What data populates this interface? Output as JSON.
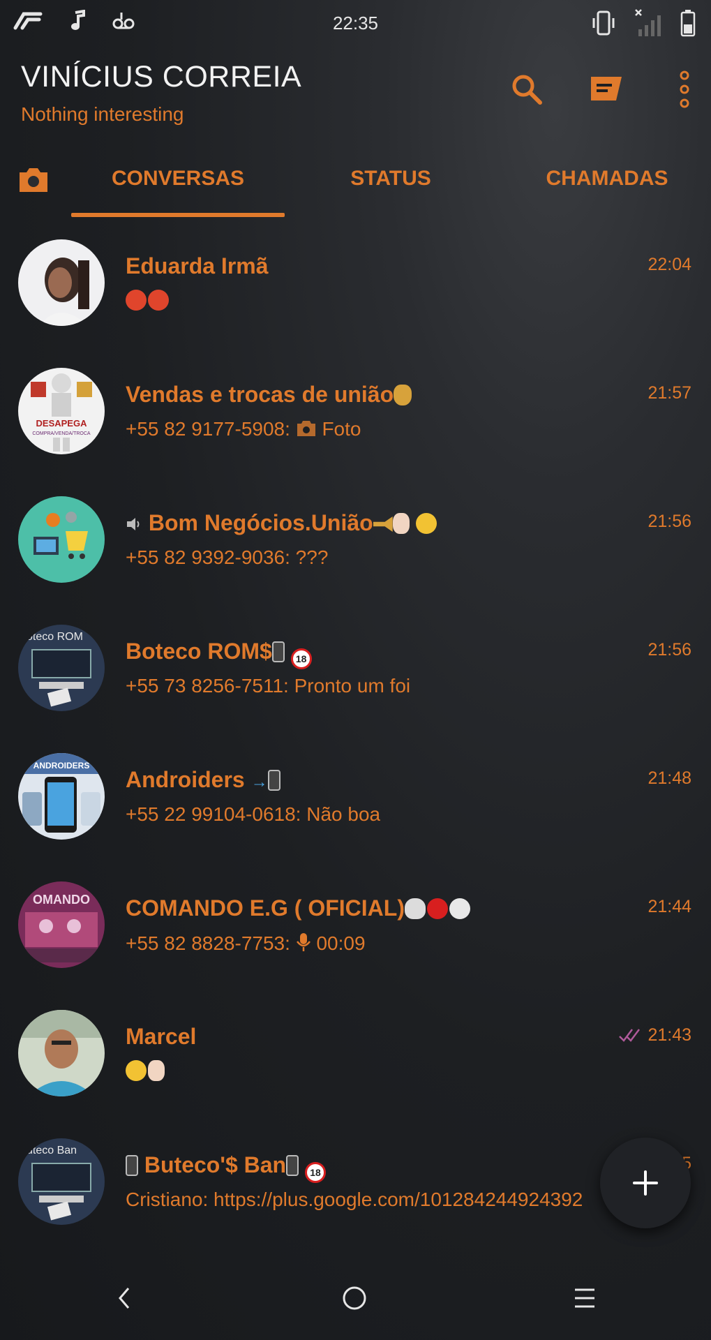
{
  "status_bar": {
    "time": "22:35"
  },
  "header": {
    "title": "VINÍCIUS CORREIA",
    "subtitle": "Nothing interesting",
    "icons": [
      "search-icon",
      "new-chat-icon",
      "more-vert-icon"
    ]
  },
  "tabs": [
    {
      "label": "CONVERSAS",
      "active": true
    },
    {
      "label": "STATUS",
      "active": false
    },
    {
      "label": "CHAMADAS",
      "active": false
    }
  ],
  "chats": [
    {
      "name": "Eduarda Irmã",
      "message": "",
      "time": "22:04"
    },
    {
      "name": "Vendas e trocas de união",
      "sender": "+55 82 9177-5908:",
      "message": "Foto",
      "time": "21:57"
    },
    {
      "name": "Bom Negócios.União",
      "sender": "+55 82 9392-9036:",
      "message": "???",
      "time": "21:56"
    },
    {
      "name": "Boteco ROM$",
      "sender": "+55 73 8256-7511:",
      "message": "Pronto um foi",
      "time": "21:56"
    },
    {
      "name": "Androiders",
      "sender": "+55 22 99104-0618:",
      "message": "Não boa",
      "time": "21:48"
    },
    {
      "name": "COMANDO E.G ( OFICIAL)",
      "sender": "+55 82 8828-7753:",
      "message": "00:09",
      "time": "21:44"
    },
    {
      "name": "Marcel",
      "message": "",
      "time": "21:43"
    },
    {
      "name": "Buteco'$ Ban",
      "sender": "Cristiano:",
      "message": "https://plus.google.com/101284244924392",
      "time": "5"
    }
  ],
  "avatar_text": {
    "vendas": "DESAPEGA",
    "vendas_sub": "COMPRA/VENDA/TROCA",
    "boteco": "oteco ROM",
    "androiders": "ANDROIDERS",
    "comando": "OMANDO",
    "buteco": "uteco Ban"
  },
  "colors": {
    "accent": "#e07a2c",
    "background": "#1b1d20",
    "title": "#f2f2f2"
  },
  "fab": {
    "icon": "plus-icon"
  },
  "nav": [
    "back-icon",
    "home-icon",
    "menu-icon"
  ]
}
